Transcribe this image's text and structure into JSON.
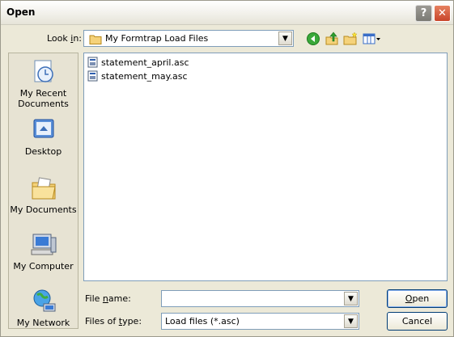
{
  "window": {
    "title": "Open"
  },
  "titlebar": {
    "help_glyph": "?",
    "close_glyph": "✕"
  },
  "lookin": {
    "label_pre": "Look ",
    "label_ul": "i",
    "label_post": "n:",
    "value": "My Formtrap Load Files"
  },
  "places": [
    {
      "label": "My Recent Documents",
      "icon": "recent-documents-icon"
    },
    {
      "label": "Desktop",
      "icon": "desktop-icon"
    },
    {
      "label": "My Documents",
      "icon": "my-documents-icon"
    },
    {
      "label": "My Computer",
      "icon": "my-computer-icon"
    },
    {
      "label": "My Network",
      "icon": "my-network-icon"
    }
  ],
  "files": [
    {
      "name": "statement_april.asc"
    },
    {
      "name": "statement_may.asc"
    }
  ],
  "filename": {
    "label_pre": "File ",
    "label_ul": "n",
    "label_post": "ame:",
    "value": ""
  },
  "filetype": {
    "label_pre": "Files of ",
    "label_ul": "t",
    "label_post": "ype:",
    "value": "Load files (*.asc)"
  },
  "buttons": {
    "open_ul": "O",
    "open_rest": "pen",
    "cancel": "Cancel"
  },
  "colors": {
    "dialog_bg": "#ece9d8",
    "border_blue": "#7f9db9",
    "close_red": "#c8452a"
  }
}
